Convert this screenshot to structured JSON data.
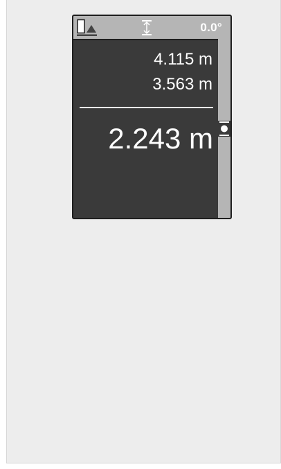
{
  "status_bar": {
    "reference_icon": "device-rear-reference-icon",
    "mode_icon": "height-measurement-icon",
    "angle": "0.0°"
  },
  "measurements": {
    "first": "4.115 m",
    "second": "3.563 m",
    "result": "2.243 m"
  },
  "scrollbar": {
    "marker_icon": "position-marker-icon"
  },
  "colors": {
    "screen_background": "#3a3a3a",
    "status_bar": "#b5b5b5",
    "text": "#ffffff",
    "page_background": "#ededed"
  }
}
